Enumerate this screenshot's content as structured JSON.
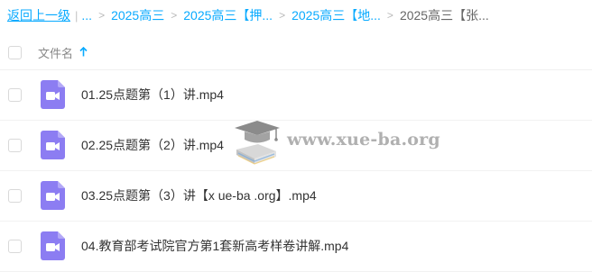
{
  "breadcrumb": {
    "back_label": "返回上一级",
    "separator": "|",
    "ellipsis": "...",
    "items": [
      "2025高三",
      "2025高三【押...",
      "2025高三【地...",
      "2025高三【张..."
    ]
  },
  "header": {
    "column_label": "文件名",
    "sort_icon": "arrow-up-icon"
  },
  "files": [
    {
      "name": "01.25点题第（1）讲.mp4",
      "icon": "video-file-icon"
    },
    {
      "name": "02.25点题第（2）讲.mp4",
      "icon": "video-file-icon"
    },
    {
      "name": "03.25点题第（3）讲【x ue-ba .org】.mp4",
      "icon": "video-file-icon"
    },
    {
      "name": "04.教育部考试院官方第1套新高考样卷讲解.mp4",
      "icon": "video-file-icon"
    }
  ],
  "watermark": {
    "text": "www.xue-ba.org"
  },
  "colors": {
    "accent": "#09aaff",
    "video_icon": "#8c7df2"
  }
}
